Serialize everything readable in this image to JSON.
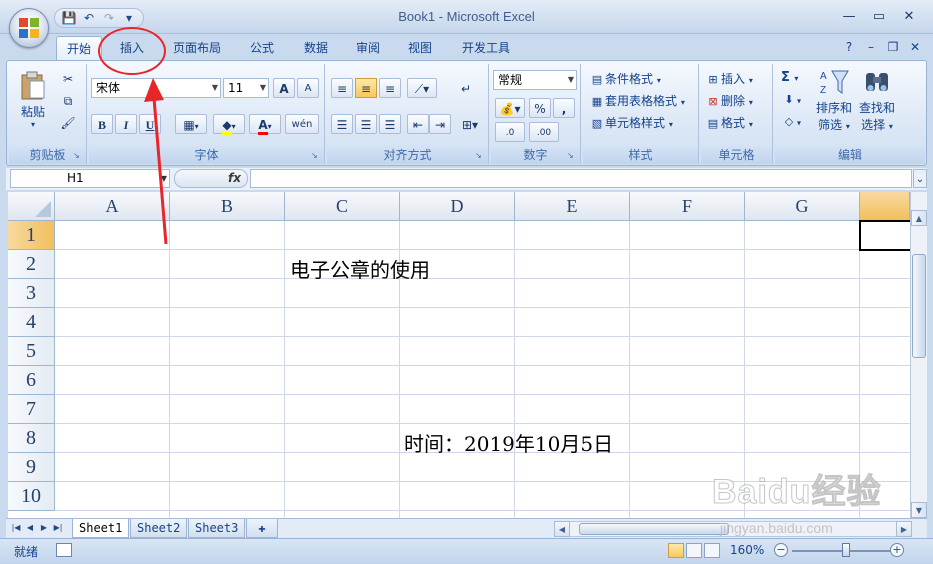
{
  "window": {
    "title": "Book1 - Microsoft Excel",
    "controls": [
      "minimize",
      "maximize",
      "close"
    ]
  },
  "qat": {
    "icons": [
      "save-icon",
      "undo-icon",
      "redo-icon",
      "customize-icon"
    ]
  },
  "tabs": [
    {
      "label": "开始",
      "active": true
    },
    {
      "label": "插入",
      "active": false
    },
    {
      "label": "页面布局",
      "active": false
    },
    {
      "label": "公式",
      "active": false
    },
    {
      "label": "数据",
      "active": false
    },
    {
      "label": "审阅",
      "active": false
    },
    {
      "label": "视图",
      "active": false
    },
    {
      "label": "开发工具",
      "active": false
    }
  ],
  "ribbon": {
    "clipboard": {
      "label": "剪贴板",
      "paste": "粘贴"
    },
    "font": {
      "label": "字体",
      "name": "宋体",
      "size": "11",
      "bold": "B",
      "italic": "I",
      "underline": "U",
      "grow": "A",
      "shrink": "A",
      "font_color": "A",
      "phonetic": "wén"
    },
    "alignment": {
      "label": "对齐方式"
    },
    "number": {
      "label": "数字",
      "format": "常规",
      "percent": "%",
      "comma": ",",
      "inc_decimal": ".0",
      "dec_decimal": ".00"
    },
    "styles": {
      "label": "样式",
      "conditional": "条件格式",
      "table": "套用表格格式",
      "cell": "单元格样式"
    },
    "cells": {
      "label": "单元格",
      "insert": "插入",
      "delete": "删除",
      "format": "格式"
    },
    "editing": {
      "label": "编辑",
      "sort": "排序和",
      "sort2": "筛选",
      "find": "查找和",
      "find2": "选择",
      "sum": "Σ"
    }
  },
  "formula_bar": {
    "name_box": "H1",
    "fx": "fx",
    "content": ""
  },
  "sheet": {
    "columns": [
      "A",
      "B",
      "C",
      "D",
      "E",
      "F",
      "G"
    ],
    "rows": [
      "1",
      "2",
      "3",
      "4",
      "5",
      "6",
      "7",
      "8",
      "9",
      "10"
    ],
    "selected_cell": "H1",
    "cells": [
      {
        "ref": "C2",
        "value": "电子公章的使用"
      },
      {
        "ref": "D8",
        "value": "时间：2019年10月5日"
      }
    ]
  },
  "sheet_tabs": [
    "Sheet1",
    "Sheet2",
    "Sheet3"
  ],
  "status": {
    "ready": "就绪",
    "zoom": "160%"
  },
  "watermark": {
    "url": "jingyan.baidu.com",
    "brand": "Baidu经验"
  },
  "colors": {
    "accent": "#15428b",
    "selected_header": "#f1c05c",
    "annotation": "#e8262a"
  }
}
